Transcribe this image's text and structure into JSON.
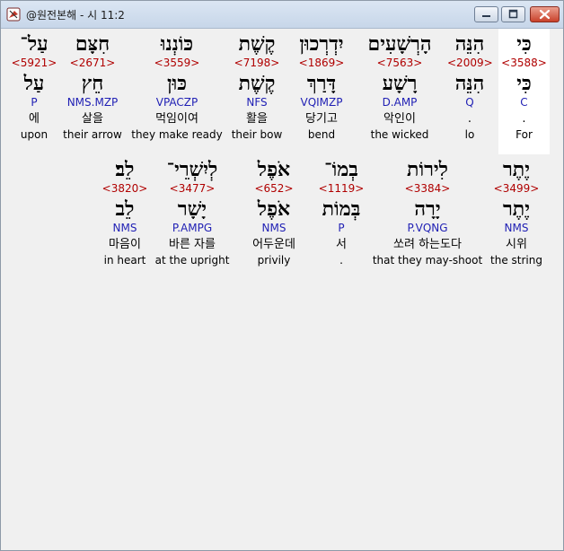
{
  "window": {
    "title": "@원전본해 - 시 11:2",
    "icon": "app-icon",
    "controls": [
      "minimize-icon",
      "maximize-icon",
      "close-icon"
    ]
  },
  "colors": {
    "strong": "#b00000",
    "morph": "#1f1fb4",
    "highlight": "#ffffff"
  },
  "rows": [
    {
      "words": [
        {
          "heb": "כִּי",
          "strong": "<3588>",
          "lemma": "כִּי",
          "morph": "C",
          "kor": ".",
          "eng": "For"
        },
        {
          "heb": "הִנֵּה",
          "strong": "<2009>",
          "lemma": "הִנֵּה",
          "morph": "Q",
          "kor": ".",
          "eng": "lo"
        },
        {
          "heb": "הָרְשָׁעִים",
          "strong": "<7563>",
          "lemma": "רָשָׁע",
          "morph": "D.AMP",
          "kor": "악인이",
          "eng": "the wicked"
        },
        {
          "heb": "יִדְרְכוּן",
          "strong": "<1869>",
          "lemma": "דָּרַךְ",
          "morph": "VQIMZP",
          "kor": "당기고",
          "eng": "bend"
        },
        {
          "heb": "קֶשֶׁת",
          "strong": "<7198>",
          "lemma": "קֶשֶׁת",
          "morph": "NFS",
          "kor": "활을",
          "eng": "their bow"
        },
        {
          "heb": "כּוֹנְנוּ",
          "strong": "<3559>",
          "lemma": "כּוּן",
          "morph": "VPACZP",
          "kor": "먹임이여",
          "eng": "they make ready"
        },
        {
          "heb": "חִצָּם",
          "strong": "<2671>",
          "lemma": "חֵץ",
          "morph": "NMS.MZP",
          "kor": "살을",
          "eng": "their arrow"
        },
        {
          "heb": "עַל־",
          "strong": "<5921>",
          "lemma": "עַל",
          "morph": "P",
          "kor": "에",
          "eng": "upon"
        }
      ]
    },
    {
      "words": [
        {
          "heb": "יֶתֶר",
          "strong": "<3499>",
          "lemma": "יֶתֶר",
          "morph": "NMS",
          "kor": "시위",
          "eng": "the string"
        },
        {
          "heb": "לִירוֹת",
          "strong": "<3384>",
          "lemma": "יָרָה",
          "morph": "P.VQNG",
          "kor": "쏘려 하는도다",
          "eng": "that they may-shoot"
        },
        {
          "heb": "בְמוֹ־",
          "strong": "<1119>",
          "lemma": "בְּמוֹת",
          "morph": "P",
          "kor": "서",
          "eng": "."
        },
        {
          "heb": "אֹפֶל",
          "strong": "<652>",
          "lemma": "אֹפֶל",
          "morph": "NMS",
          "kor": "어두운데",
          "eng": "privily"
        },
        {
          "heb": "לְיִשְׁרֵי־",
          "strong": "<3477>",
          "lemma": "יָשָׁר",
          "morph": "P.AMPG",
          "kor": "바른 자를",
          "eng": "at the upright"
        },
        {
          "heb": "לֵב׃",
          "strong": "<3820>",
          "lemma": "לֵב",
          "morph": "NMS",
          "kor": "마음이",
          "eng": "in heart"
        }
      ]
    }
  ]
}
